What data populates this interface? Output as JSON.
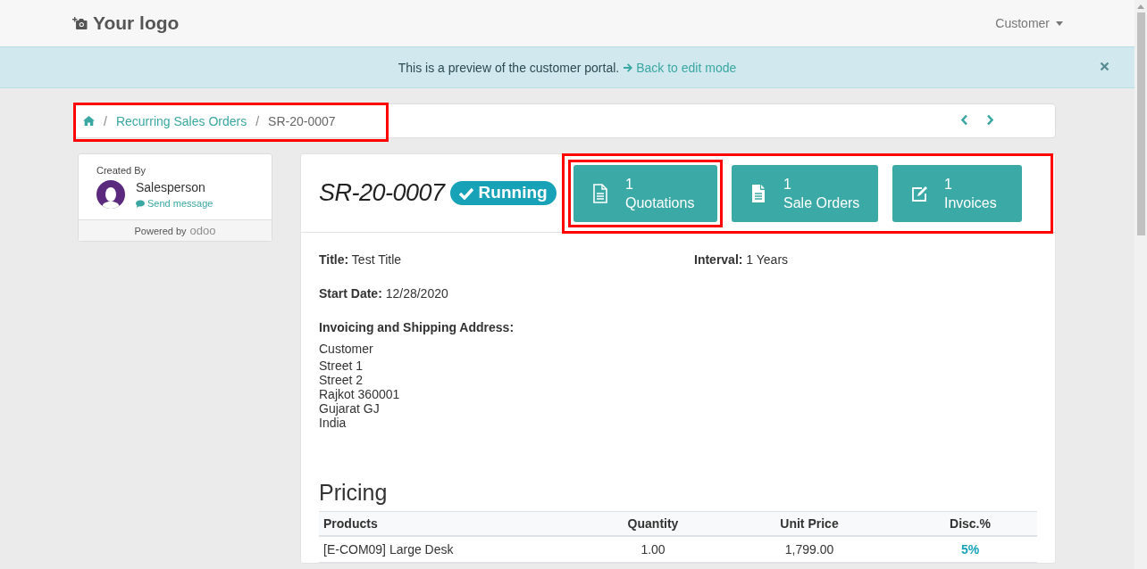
{
  "navbar": {
    "logo": "Your logo",
    "user_menu": "Customer"
  },
  "preview_alert": {
    "message": "This is a preview of the customer portal.",
    "link": "Back to edit mode"
  },
  "breadcrumb": {
    "highlighted": true,
    "separator": "/",
    "items": [
      {
        "kind": "home"
      },
      {
        "kind": "link",
        "label": "Recurring Sales Orders"
      },
      {
        "kind": "current",
        "label": "SR-20-0007"
      }
    ]
  },
  "sidebar": {
    "heading": "Created By",
    "name": "Salesperson",
    "link": "Send message",
    "powered_by": "Powered by",
    "brand": "odoo"
  },
  "record": {
    "title": "SR-20-0007",
    "status": "Running",
    "stat_group_highlighted": true,
    "stat_buttons": [
      {
        "kind": "quotations",
        "count": "1",
        "label": "Quotations",
        "highlighted": true
      },
      {
        "kind": "orders",
        "count": "1",
        "label": "Sale Orders",
        "highlighted": false
      },
      {
        "kind": "invoices",
        "count": "1",
        "label": "Invoices",
        "highlighted": false
      }
    ]
  },
  "fields": [
    {
      "label": "Title:",
      "value": "Test Title"
    },
    {
      "label": "Interval:",
      "value": "1 Years"
    },
    {
      "label": "Start Date:",
      "value": "12/28/2020"
    }
  ],
  "address": {
    "heading": "Invoicing and Shipping Address:",
    "name": "Customer",
    "lines": [
      "Street 1",
      "Street 2",
      "Rajkot 360001",
      "Gujarat GJ",
      "India"
    ]
  },
  "pricing": {
    "heading": "Pricing",
    "columns": [
      "Products",
      "Quantity",
      "Unit Price",
      "Disc.%"
    ],
    "rows": [
      [
        "[E-COM09] Large Desk",
        "1.00",
        "1,799.00",
        "5%"
      ]
    ]
  }
}
